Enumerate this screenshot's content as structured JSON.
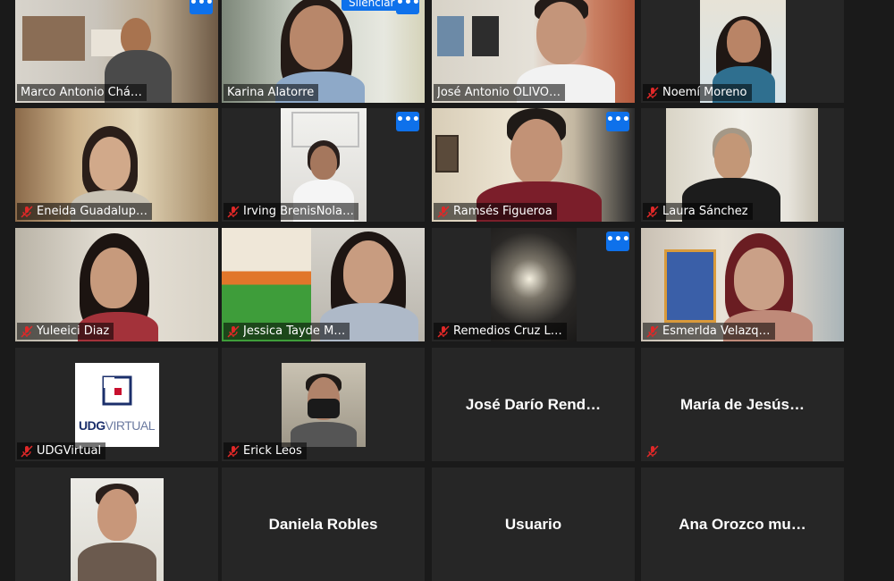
{
  "participants": [
    {
      "name": "Marco Antonio Chá…",
      "muted": false,
      "more": true
    },
    {
      "name": "Karina Alatorre",
      "muted": false,
      "more": true,
      "mute_button": "Silenciar",
      "active": true
    },
    {
      "name": "José Antonio OLIVO…",
      "muted": false,
      "more": false
    },
    {
      "name": "Noemí Moreno",
      "muted": true,
      "more": false
    },
    {
      "name": "Eneida Guadalup…",
      "muted": true,
      "more": false
    },
    {
      "name": "Irving BrenisNola…",
      "muted": true,
      "more": true
    },
    {
      "name": "Ramsés Figueroa",
      "muted": true,
      "more": true
    },
    {
      "name": "Laura Sánchez",
      "muted": true,
      "more": false
    },
    {
      "name": "Yuleeici Diaz",
      "muted": true,
      "more": false
    },
    {
      "name": "Jessica Tayde M…",
      "muted": true,
      "more": false
    },
    {
      "name": "Remedios Cruz L…",
      "muted": true,
      "more": true
    },
    {
      "name": "Esmerlda Velazq…",
      "muted": true,
      "more": false
    },
    {
      "name": "UDGVirtual",
      "muted": true,
      "more": false,
      "logo_text": "UDGVIRTUAL"
    },
    {
      "name": "Erick Leos",
      "muted": true,
      "more": false
    },
    {
      "name": "José Darío Rend…",
      "muted": false,
      "more": false,
      "no_video": true
    },
    {
      "name": "María de Jesús…",
      "muted": true,
      "more": false,
      "no_video": true
    },
    {
      "name": "",
      "muted": false,
      "more": false
    },
    {
      "name": "Daniela Robles",
      "muted": false,
      "more": false,
      "no_video": true
    },
    {
      "name": "Usuario",
      "muted": false,
      "more": false,
      "no_video": true
    },
    {
      "name": "Ana Orozco mu…",
      "muted": false,
      "more": false,
      "no_video": true
    }
  ],
  "more_glyph": "•••",
  "colors": {
    "active_border": "#8fd400",
    "accent": "#0e71eb",
    "muted_icon": "#e02828",
    "tile_bg": "#262626"
  }
}
